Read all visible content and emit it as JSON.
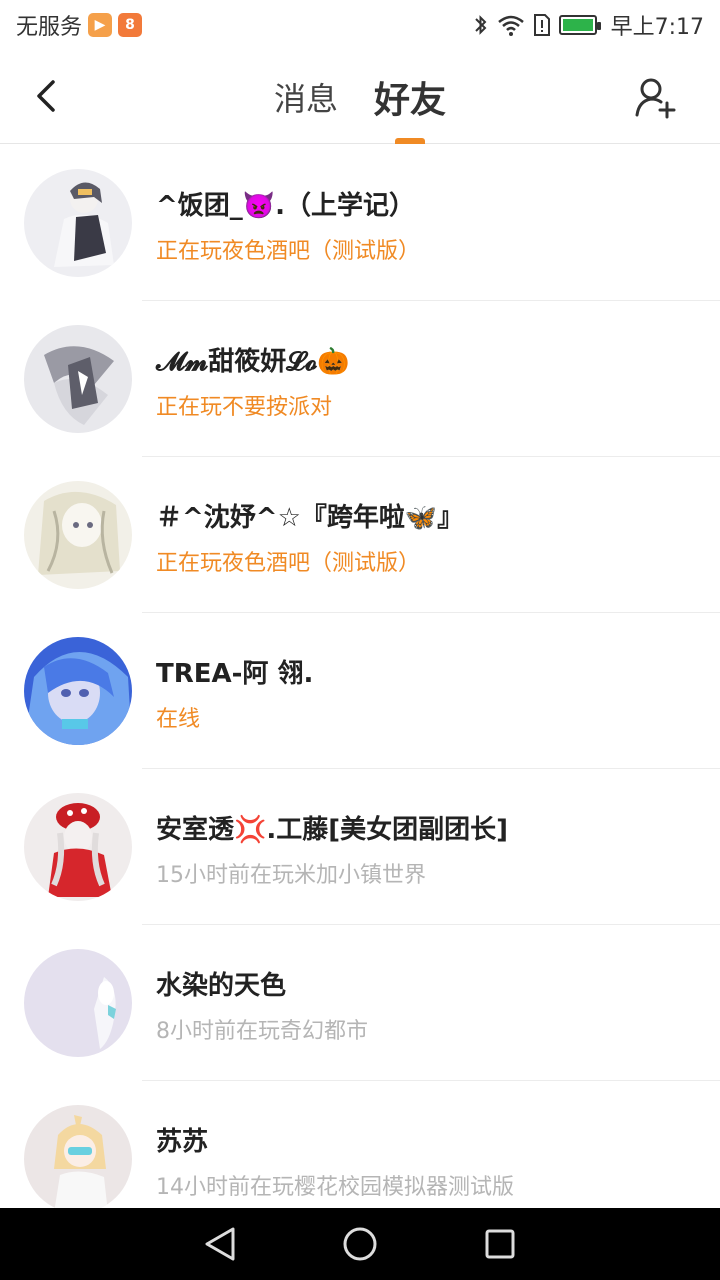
{
  "status_bar": {
    "carrier": "无服务",
    "time": "早上7:17",
    "battery_level": 1.0,
    "colors": {
      "battery": "#2db34a"
    },
    "app_icons": [
      "video-app-icon",
      "chat-app-icon"
    ]
  },
  "header": {
    "tabs": [
      {
        "label": "消息",
        "active": false
      },
      {
        "label": "好友",
        "active": true
      }
    ],
    "accent_color": "#f08a24"
  },
  "friends": [
    {
      "name": "^饭团_👿.（上学记）",
      "status": "正在玩夜色酒吧（测试版）",
      "online": true
    },
    {
      "name": "𝓜𝓶甜筱妍𝓛𝓸🎃",
      "status": "正在玩不要按派对",
      "online": true
    },
    {
      "name": "＃^沈妤^☆『跨年啦🦋』",
      "status": "正在玩夜色酒吧（测试版）",
      "online": true
    },
    {
      "name": "TREA-阿  翎.",
      "status": "在线",
      "online": true
    },
    {
      "name": "安室透💢.工藤[美女团副团长]",
      "status": "15小时前在玩米加小镇世界",
      "online": false
    },
    {
      "name": "水染的天色",
      "status": "8小时前在玩奇幻都市",
      "online": false
    },
    {
      "name": "苏苏",
      "status": "14小时前在玩樱花校园模拟器测试版",
      "online": false
    }
  ]
}
